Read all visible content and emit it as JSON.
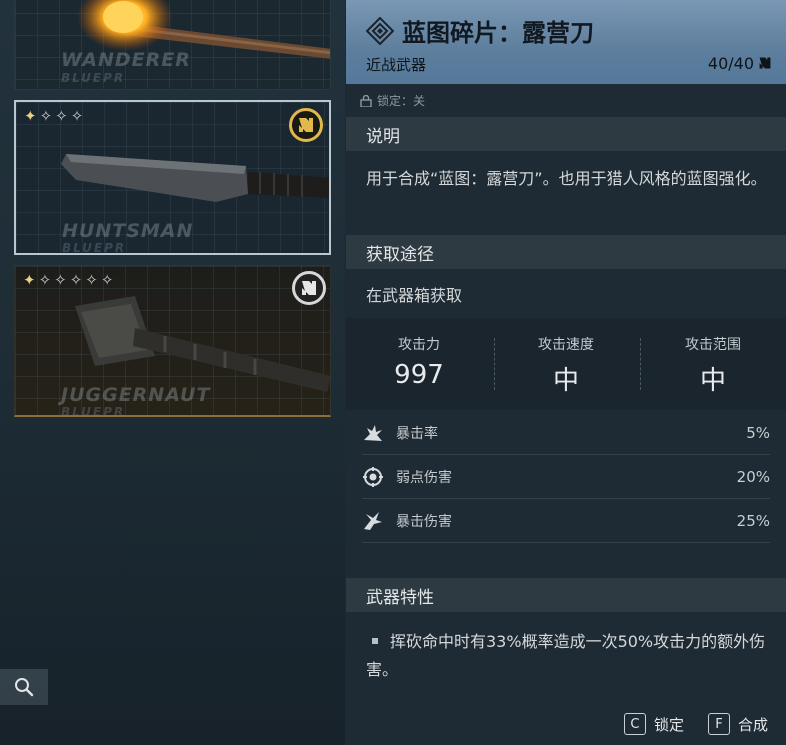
{
  "cards": [
    {
      "name": "WANDERER",
      "subtitle": "BLUEPR"
    },
    {
      "name": "HUNTSMAN",
      "subtitle": "BLUEPR",
      "stars": "✦✧✧✧"
    },
    {
      "name": "JUGGERNAUT",
      "subtitle": "BLUEPR",
      "stars": "✦✧✧✧✧✧"
    }
  ],
  "detail": {
    "title": "蓝图碎片：露营刀",
    "type": "近战武器",
    "count": "40/40",
    "lock_status": "锁定：关",
    "description_header": "说明",
    "description": "用于合成“蓝图：露营刀”。也用于猎人风格的蓝图强化。",
    "acquire_header": "获取途径",
    "acquire": "在武器箱获取",
    "stats": [
      {
        "label": "攻击力",
        "value": "997"
      },
      {
        "label": "攻击速度",
        "value": "中"
      },
      {
        "label": "攻击范围",
        "value": "中"
      }
    ],
    "sub_stats": [
      {
        "label": "暴击率",
        "value": "5%",
        "icon": "crit-rate-icon"
      },
      {
        "label": "弱点伤害",
        "value": "20%",
        "icon": "weakspot-icon"
      },
      {
        "label": "暴击伤害",
        "value": "25%",
        "icon": "crit-damage-icon"
      }
    ],
    "traits_header": "武器特性",
    "trait": "挥砍命中时有33%概率造成一次50%攻击力的额外伤害。"
  },
  "hotkeys": [
    {
      "key": "C",
      "label": "锁定"
    },
    {
      "key": "F",
      "label": "合成"
    }
  ],
  "colors": {
    "accent_gold": "#e2b84a",
    "title_bar": "#6b8cab"
  }
}
